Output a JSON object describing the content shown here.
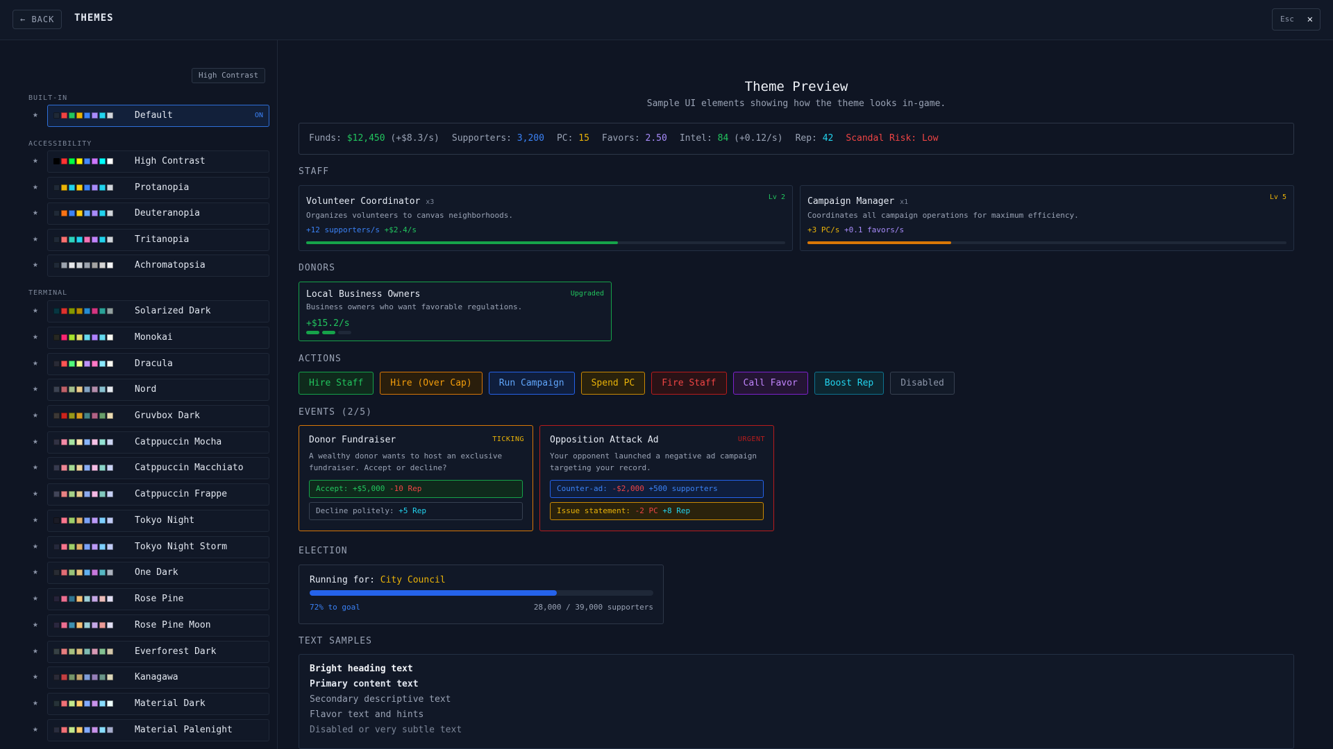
{
  "topbar": {
    "back_label": "← BACK",
    "title": "THEMES",
    "esc_label": "Esc",
    "close_glyph": "✕"
  },
  "sidebar": {
    "high_contrast_toggle": "High Contrast",
    "star_glyph": "★",
    "sections": {
      "builtin": "BUILT-IN",
      "accessibility": "ACCESSIBILITY",
      "terminal": "TERMINAL"
    },
    "active_badge": "ON",
    "themes": [
      {
        "name": "Default",
        "swatches": [
          "#1f2937",
          "#ef4444",
          "#22c55e",
          "#eab308",
          "#3b82f6",
          "#a78bfa",
          "#22d3ee",
          "#d1d5db"
        ]
      },
      {
        "name": "High Contrast",
        "swatches": [
          "#000000",
          "#ff3333",
          "#00ff44",
          "#ffee00",
          "#4488ff",
          "#cc77ff",
          "#00ffff",
          "#ffffff"
        ]
      },
      {
        "name": "Protanopia",
        "swatches": [
          "#1f2937",
          "#eab308",
          "#22d3ee",
          "#facc15",
          "#3b82f6",
          "#a78bfa",
          "#22d3ee",
          "#d1d5db"
        ]
      },
      {
        "name": "Deuteranopia",
        "swatches": [
          "#1f2937",
          "#f97316",
          "#3b82f6",
          "#facc15",
          "#60a5fa",
          "#a78bfa",
          "#22d3ee",
          "#d1d5db"
        ]
      },
      {
        "name": "Tritanopia",
        "swatches": [
          "#1f2937",
          "#f87171",
          "#2dd4bf",
          "#22d3ee",
          "#f472b6",
          "#c084fc",
          "#22d3ee",
          "#d1d5db"
        ]
      },
      {
        "name": "Achromatopsia",
        "swatches": [
          "#1f2937",
          "#9ca3af",
          "#e5e7eb",
          "#d1d5db",
          "#9ca3af",
          "#a3a3a3",
          "#d4d4d4",
          "#f3f4f6"
        ]
      },
      {
        "name": "Solarized Dark",
        "swatches": [
          "#073642",
          "#dc322f",
          "#859900",
          "#b58900",
          "#268bd2",
          "#d33682",
          "#2aa198",
          "#93a1a1"
        ]
      },
      {
        "name": "Monokai",
        "swatches": [
          "#272822",
          "#f92672",
          "#a6e22e",
          "#e6db74",
          "#66d9ef",
          "#ae81ff",
          "#66d9ef",
          "#f8f8f2"
        ]
      },
      {
        "name": "Dracula",
        "swatches": [
          "#282a36",
          "#ff5555",
          "#50fa7b",
          "#f1fa8c",
          "#bd93f9",
          "#ff79c6",
          "#8be9fd",
          "#f8f8f2"
        ]
      },
      {
        "name": "Nord",
        "swatches": [
          "#3b4252",
          "#bf616a",
          "#a3be8c",
          "#ebcb8b",
          "#81a1c1",
          "#b48ead",
          "#88c0d0",
          "#e5e9f0"
        ]
      },
      {
        "name": "Gruvbox Dark",
        "swatches": [
          "#3c3836",
          "#cc241d",
          "#98971a",
          "#d79921",
          "#458588",
          "#b16286",
          "#689d6a",
          "#ebdbb2"
        ]
      },
      {
        "name": "Catppuccin Mocha",
        "swatches": [
          "#313244",
          "#f38ba8",
          "#a6e3a1",
          "#f9e2af",
          "#89b4fa",
          "#f5c2e7",
          "#94e2d5",
          "#cdd6f4"
        ]
      },
      {
        "name": "Catppuccin Macchiato",
        "swatches": [
          "#363a4f",
          "#ed8796",
          "#a6da95",
          "#eed49f",
          "#8aadf4",
          "#f5bde6",
          "#8bd5ca",
          "#cad3f5"
        ]
      },
      {
        "name": "Catppuccin Frappe",
        "swatches": [
          "#414559",
          "#e78284",
          "#a6d189",
          "#e5c890",
          "#8caaee",
          "#f4b8e4",
          "#81c8be",
          "#c6d0f5"
        ]
      },
      {
        "name": "Tokyo Night",
        "swatches": [
          "#1a1b26",
          "#f7768e",
          "#9ece6a",
          "#e0af68",
          "#7aa2f7",
          "#bb9af7",
          "#7dcfff",
          "#c0caf5"
        ]
      },
      {
        "name": "Tokyo Night Storm",
        "swatches": [
          "#24283b",
          "#f7768e",
          "#9ece6a",
          "#e0af68",
          "#7aa2f7",
          "#bb9af7",
          "#7dcfff",
          "#c0caf5"
        ]
      },
      {
        "name": "One Dark",
        "swatches": [
          "#282c34",
          "#e06c75",
          "#98c379",
          "#e5c07b",
          "#61afef",
          "#c678dd",
          "#56b6c2",
          "#abb2bf"
        ]
      },
      {
        "name": "Rose Pine",
        "swatches": [
          "#26233a",
          "#eb6f92",
          "#31748f",
          "#f6c177",
          "#9ccfd8",
          "#c4a7e7",
          "#ebbcba",
          "#e0def4"
        ]
      },
      {
        "name": "Rose Pine Moon",
        "swatches": [
          "#2a273f",
          "#eb6f92",
          "#3e8fb0",
          "#f6c177",
          "#9ccfd8",
          "#c4a7e7",
          "#ea9a97",
          "#e0def4"
        ]
      },
      {
        "name": "Everforest Dark",
        "swatches": [
          "#374145",
          "#e67e80",
          "#a7c080",
          "#dbbc7f",
          "#7fbbb3",
          "#d699b6",
          "#83c092",
          "#d3c6aa"
        ]
      },
      {
        "name": "Kanagawa",
        "swatches": [
          "#2a2a37",
          "#c34043",
          "#76946a",
          "#c0a36e",
          "#7e9cd8",
          "#957fb8",
          "#6a9589",
          "#dcd7ba"
        ]
      },
      {
        "name": "Material Dark",
        "swatches": [
          "#263238",
          "#f07178",
          "#c3e88d",
          "#ffcb6b",
          "#82aaff",
          "#c792ea",
          "#89ddff",
          "#eeffff"
        ]
      },
      {
        "name": "Material Palenight",
        "swatches": [
          "#292d3e",
          "#f07178",
          "#c3e88d",
          "#ffcb6b",
          "#82aaff",
          "#c792ea",
          "#89ddff",
          "#a6accd"
        ]
      }
    ]
  },
  "preview": {
    "title": "Theme Preview",
    "subtitle": "Sample UI elements showing how the theme looks in-game.",
    "stats": {
      "funds_label": "Funds:",
      "funds_value": "$12,450",
      "funds_rate": "(+$8.3/s)",
      "supporters_label": "Supporters:",
      "supporters_value": "3,200",
      "pc_label": "PC:",
      "pc_value": "15",
      "favors_label": "Favors:",
      "favors_value": "2.50",
      "intel_label": "Intel:",
      "intel_value": "84",
      "intel_rate": "(+0.12/s)",
      "rep_label": "Rep:",
      "rep_value": "42",
      "scandal": "Scandal Risk: Low"
    },
    "staff_heading": "STAFF",
    "staff": [
      {
        "name": "Volunteer Coordinator",
        "mult": "x3",
        "level": "Lv 2",
        "desc": "Organizes volunteers to canvas neighborhoods.",
        "rate1": "+12 supporters/s",
        "rate2": "+$2.4/s",
        "progress": 0.65
      },
      {
        "name": "Campaign Manager",
        "mult": "x1",
        "level": "Lv 5",
        "desc": "Coordinates all campaign operations for maximum efficiency.",
        "rate1": "+3 PC/s",
        "rate2": "+0.1 favors/s",
        "progress": 0.3
      }
    ],
    "donors_heading": "DONORS",
    "donor": {
      "name": "Local Business Owners",
      "status": "Upgraded",
      "desc": "Business owners who want favorable regulations.",
      "rate": "+$15.2/s",
      "pips_filled": 2,
      "pips_total": 3
    },
    "actions_heading": "ACTIONS",
    "actions": [
      "Hire Staff",
      "Hire (Over Cap)",
      "Run Campaign",
      "Spend PC",
      "Fire Staff",
      "Call Favor",
      "Boost Rep",
      "Disabled"
    ],
    "events_heading": "EVENTS (2/5)",
    "events": [
      {
        "title": "Donor Fundraiser",
        "badge": "TICKING",
        "desc": "A wealthy donor wants to host an exclusive fundraiser. Accept or decline?",
        "choice1_a": "Accept:",
        "choice1_b": "+$5,000",
        "choice1_c": "-10 Rep",
        "choice2_a": "Decline politely:",
        "choice2_b": "+5 Rep"
      },
      {
        "title": "Opposition Attack Ad",
        "badge": "URGENT",
        "desc": "Your opponent launched a negative ad campaign targeting your record.",
        "choice1_a": "Counter-ad:",
        "choice1_b": "-$2,000",
        "choice1_c": "+500 supporters",
        "choice2_a": "Issue statement:",
        "choice2_b": "-2 PC",
        "choice2_c": "+8 Rep"
      }
    ],
    "election_heading": "ELECTION",
    "election": {
      "running_label": "Running for:",
      "office": "City Council",
      "progress": 0.72,
      "pct_text": "72% to goal",
      "count_text": "28,000 / 39,000 supporters"
    },
    "text_heading": "TEXT SAMPLES",
    "text_samples": [
      "Bright heading text",
      "Primary content text",
      "Secondary descriptive text",
      "Flavor text and hints",
      "Disabled or very subtle text"
    ]
  }
}
